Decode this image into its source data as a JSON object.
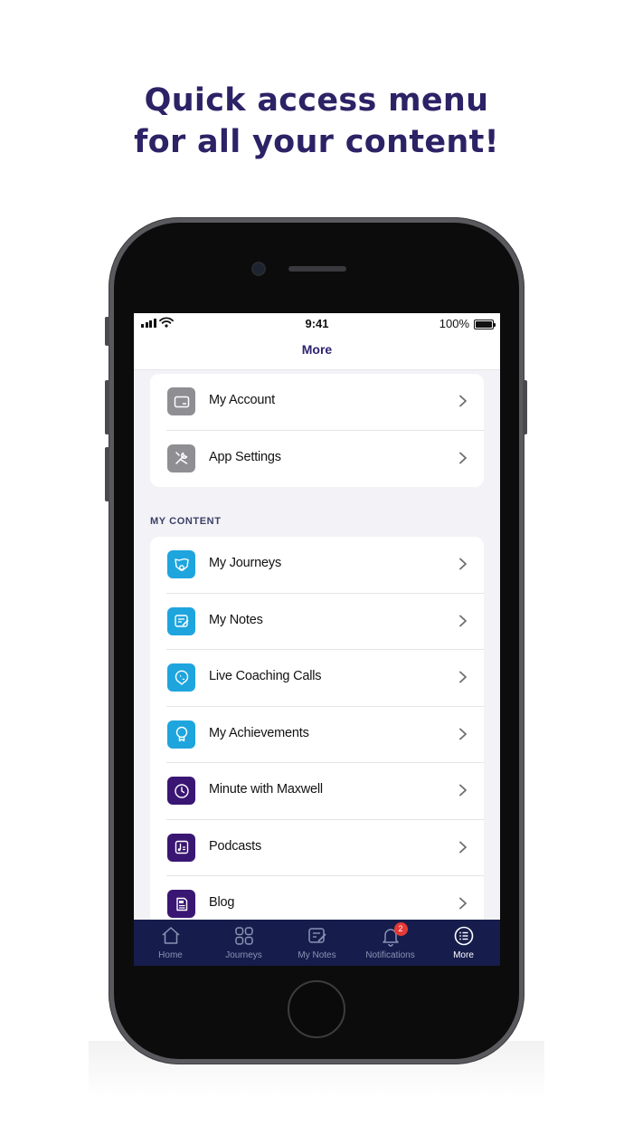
{
  "headline": {
    "line1": "Quick access menu",
    "line2": "for all your content!",
    "color": "#2c2266"
  },
  "status_bar": {
    "time": "9:41",
    "battery": "100%"
  },
  "nav": {
    "title": "More"
  },
  "account_section": {
    "items": [
      {
        "label": "My Account",
        "icon": "card-icon",
        "icon_bg": "#8e8e93"
      },
      {
        "label": "App Settings",
        "icon": "tools-icon",
        "icon_bg": "#8e8e93"
      }
    ]
  },
  "content_section": {
    "header": "MY CONTENT",
    "items": [
      {
        "label": "My Journeys",
        "icon": "map-icon",
        "icon_bg": "#1ea5de"
      },
      {
        "label": "My Notes",
        "icon": "notes-icon",
        "icon_bg": "#1ea5de"
      },
      {
        "label": "Live Coaching Calls",
        "icon": "phone-icon",
        "icon_bg": "#1ea5de"
      },
      {
        "label": "My Achievements",
        "icon": "award-icon",
        "icon_bg": "#1ea5de"
      },
      {
        "label": "Minute with Maxwell",
        "icon": "clock-icon",
        "icon_bg": "#3a1673"
      },
      {
        "label": "Podcasts",
        "icon": "podcast-icon",
        "icon_bg": "#3a1673"
      },
      {
        "label": "Blog",
        "icon": "blog-icon",
        "icon_bg": "#3a1673"
      }
    ]
  },
  "tab_bar": {
    "background": "#161d4c",
    "tabs": [
      {
        "label": "Home",
        "icon": "home-icon",
        "active": false
      },
      {
        "label": "Journeys",
        "icon": "grid-icon",
        "active": false
      },
      {
        "label": "My Notes",
        "icon": "notes-icon",
        "active": false
      },
      {
        "label": "Notifications",
        "icon": "bell-icon",
        "active": false,
        "badge": "2"
      },
      {
        "label": "More",
        "icon": "list-icon",
        "active": true
      }
    ]
  }
}
